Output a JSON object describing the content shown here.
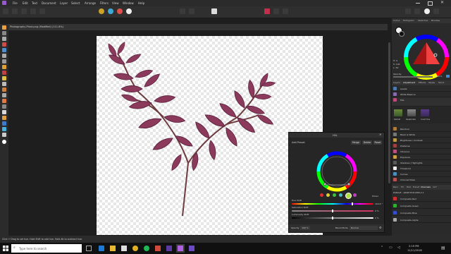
{
  "menu": [
    "File",
    "Edit",
    "Text",
    "Document",
    "Layer",
    "Select",
    "Arrange",
    "Filters",
    "View",
    "Window",
    "Help"
  ],
  "document_tab": "Photography-Plant.png (Modified) (111.6%)",
  "right_panel": {
    "top_tabs": [
      "Colour",
      "Histogram",
      "Swatches",
      "Brushes"
    ],
    "hsl_readout": [
      "H: 0",
      "S: 100",
      "L: 50"
    ],
    "opacity_label": "Opacity",
    "opacity_value": "100 %",
    "mid_tabs": [
      "Layers",
      "Adjustment",
      "Effects",
      "Styles",
      "Stock"
    ],
    "adjustments": [
      {
        "label": "Levels",
        "color": "#4a7ab0"
      },
      {
        "label": "White Balance",
        "color": "#8a6ab0"
      },
      {
        "label": "HSL",
        "color": "#c04a7a"
      },
      {
        "label": "Recolour",
        "color": "#b07a3a"
      },
      {
        "label": "Black & White",
        "color": "#777777"
      },
      {
        "label": "Brightness / Contrast",
        "color": "#c09a40"
      },
      {
        "label": "Posterise",
        "color": "#a04040"
      },
      {
        "label": "Vibrance",
        "color": "#c05080"
      },
      {
        "label": "Exposure",
        "color": "#d0a040"
      },
      {
        "label": "Shadows / Highlights",
        "color": "#5a5a5a"
      },
      {
        "label": "Threshold",
        "color": "#eeeeee"
      },
      {
        "label": "Curves",
        "color": "#4a90c0"
      },
      {
        "label": "Channel Mixer",
        "color": "#c05050"
      }
    ],
    "presets": [
      "Default",
      "Desaturate",
      "Invert Hue"
    ],
    "bottom_tabs": [
      "Navi",
      "FX",
      "Hist",
      "Transf",
      "Channels",
      "127"
    ],
    "channels_header": "RGBA/8 - sRGB IEC61966-2.1",
    "channels": [
      "Composite Red",
      "Composite Green",
      "Composite Blue",
      "Composite Alpha"
    ]
  },
  "hsl_dialog": {
    "title": "HSL",
    "add_preset": "Add Preset",
    "buttons": [
      "Merge",
      "Delete",
      "Reset"
    ],
    "picker_label": "Picker",
    "hue_label": "Hue Shift",
    "hue_value": "104.6 °",
    "sat_label": "Saturation Shift",
    "sat_value": "0 %",
    "lum_label": "Luminosity Shift",
    "lum_value": "0 %",
    "opacity_label": "Opacity",
    "opacity_value": "100 %",
    "blend_label": "Blend Mode",
    "blend_value": "Normal",
    "swatches": [
      "#e03030",
      "#e0d030",
      "#40c040",
      "#40c0c0",
      "#3060e0",
      "#c040c0"
    ]
  },
  "status": {
    "text": "Click + Drag to set hue. Hold Shift to add hue. Hold Alt to subtract hue."
  },
  "taskbar": {
    "search_placeholder": "Type here to search",
    "time": "2:19 PM",
    "date": "11/11/2018"
  }
}
